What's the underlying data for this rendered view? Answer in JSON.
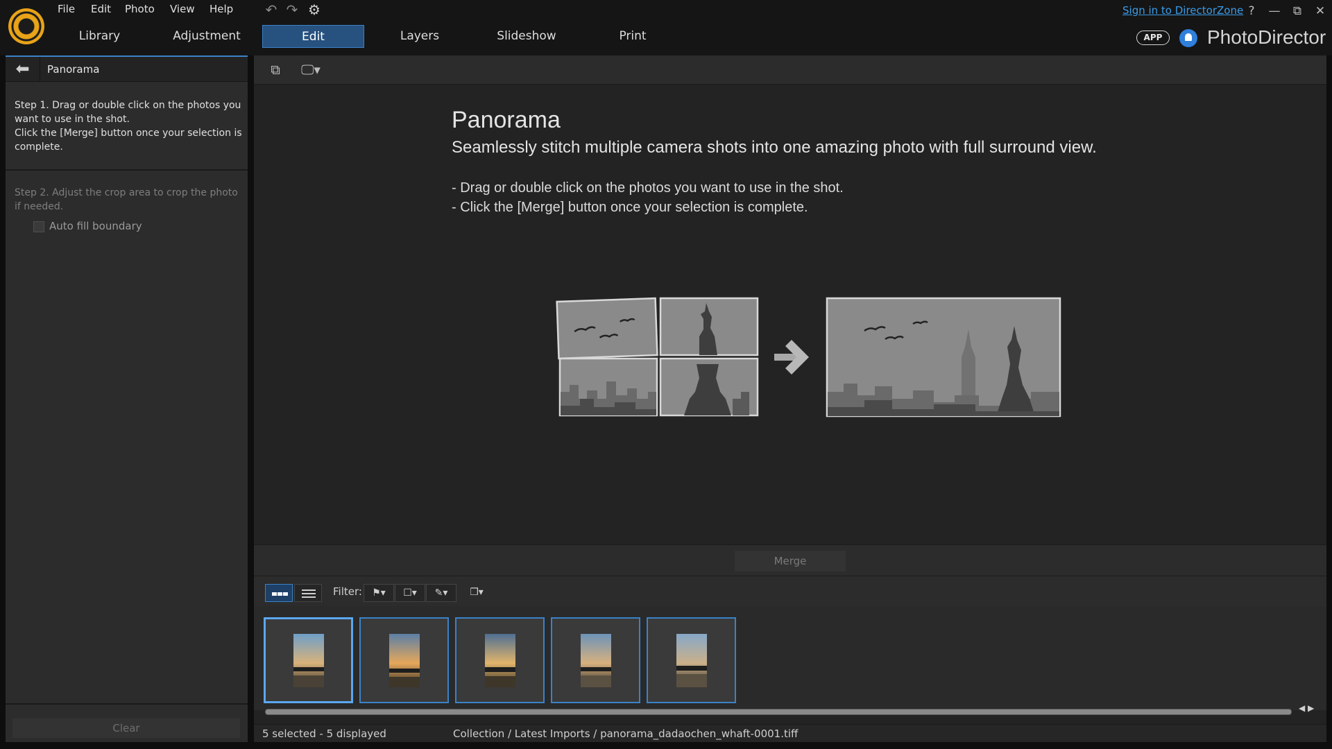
{
  "app": {
    "brand": "PhotoDirector",
    "signin": "Sign in to DirectorZone",
    "app_badge": "APP"
  },
  "menu": [
    "File",
    "Edit",
    "Photo",
    "View",
    "Help"
  ],
  "tabs": [
    "Library",
    "Adjustment",
    "Edit",
    "Layers",
    "Slideshow",
    "Print"
  ],
  "active_tab": "Edit",
  "window_controls": {
    "help": "?",
    "minimize": "—",
    "restore": "⧉",
    "close": "✕"
  },
  "left_panel": {
    "title": "Panorama",
    "step1": "Step 1. Drag or double click on the photos you want to use in the shot.\nClick the [Merge] button once your selection is complete.",
    "step2": "Step 2. Adjust the crop area to crop the photo if needed.",
    "autofill_label": "Auto fill boundary",
    "autofill_checked": false,
    "clear_label": "Clear"
  },
  "main": {
    "title": "Panorama",
    "subtitle": "Seamlessly stitch multiple camera shots into one amazing photo with full surround view.",
    "bullet1": "- Drag or double click on the photos you want to use in the shot.",
    "bullet2": "- Click the [Merge] button once your selection is complete.",
    "merge_label": "Merge"
  },
  "filter": {
    "label": "Filter:"
  },
  "filmstrip": {
    "thumbnails": [
      {
        "selected": true,
        "active": true
      },
      {
        "selected": true,
        "active": false
      },
      {
        "selected": true,
        "active": false
      },
      {
        "selected": true,
        "active": false
      },
      {
        "selected": true,
        "active": false
      }
    ]
  },
  "status": {
    "selection": "5 selected - 5 displayed",
    "path": "Collection / Latest Imports / panorama_dadaochen_whaft-0001.tiff"
  },
  "colors": {
    "accent": "#3b82c8",
    "link": "#3b9ce8",
    "logo": "#e8a317"
  }
}
